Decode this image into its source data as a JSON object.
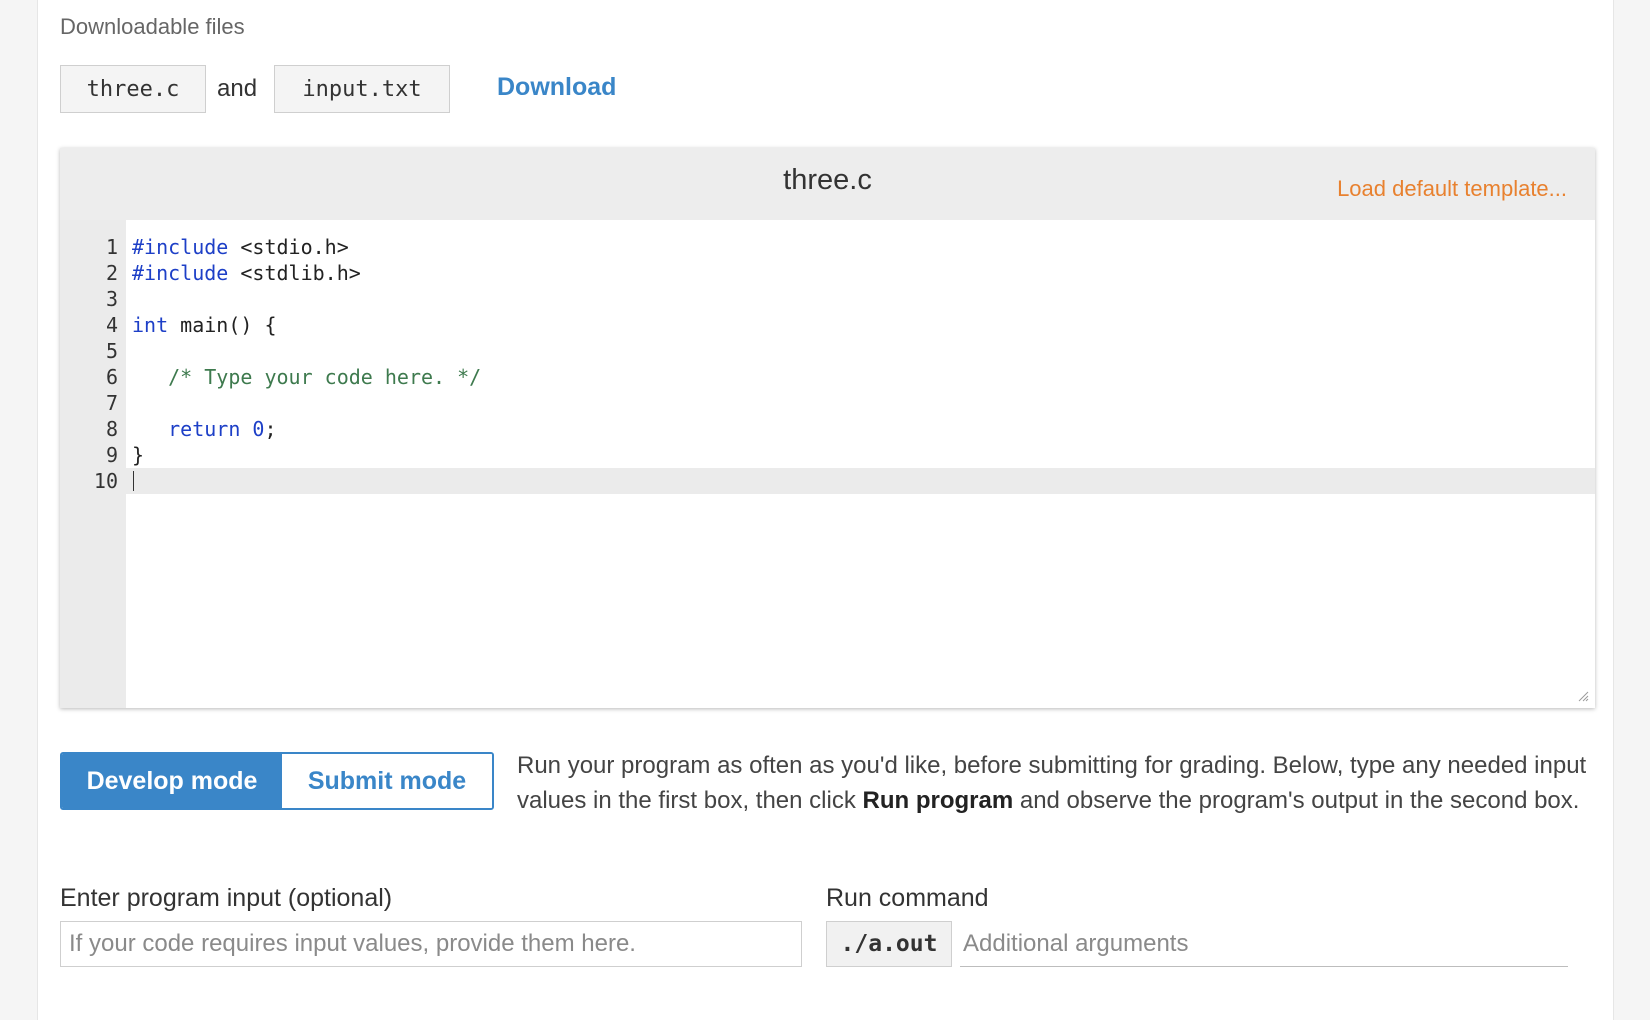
{
  "downloads": {
    "label": "Downloadable files",
    "files": [
      "three.c",
      "input.txt"
    ],
    "joiner": "and",
    "download_label": "Download"
  },
  "editor": {
    "filename": "three.c",
    "load_template_label": "Load default template...",
    "active_line": 10,
    "lines": [
      {
        "num": "1",
        "segments": [
          {
            "text": "#include",
            "style": "kw"
          },
          {
            "text": " <stdio.h>",
            "style": "plain"
          }
        ]
      },
      {
        "num": "2",
        "segments": [
          {
            "text": "#include",
            "style": "kw"
          },
          {
            "text": " <stdlib.h>",
            "style": "plain"
          }
        ]
      },
      {
        "num": "3",
        "segments": []
      },
      {
        "num": "4",
        "segments": [
          {
            "text": "int",
            "style": "kw"
          },
          {
            "text": " main() {",
            "style": "plain"
          }
        ]
      },
      {
        "num": "5",
        "segments": []
      },
      {
        "num": "6",
        "segments": [
          {
            "text": "   ",
            "style": "plain"
          },
          {
            "text": "/* Type your code here. */",
            "style": "cm"
          }
        ]
      },
      {
        "num": "7",
        "segments": []
      },
      {
        "num": "8",
        "segments": [
          {
            "text": "   ",
            "style": "plain"
          },
          {
            "text": "return",
            "style": "kw"
          },
          {
            "text": " ",
            "style": "plain"
          },
          {
            "text": "0",
            "style": "kw"
          },
          {
            "text": ";",
            "style": "plain"
          }
        ]
      },
      {
        "num": "9",
        "segments": [
          {
            "text": "}",
            "style": "plain"
          }
        ]
      },
      {
        "num": "10",
        "segments": []
      }
    ]
  },
  "modes": {
    "develop_label": "Develop mode",
    "submit_label": "Submit mode",
    "active": "develop",
    "description_before": "Run your program as often as you'd like, before submitting for grading. Below, type any needed input values in the first box, then click ",
    "description_bold": "Run program",
    "description_after": " and observe the program's output in the second box."
  },
  "program_input": {
    "label": "Enter program input (optional)",
    "placeholder": "If your code requires input values, provide them here.",
    "value": ""
  },
  "run_command": {
    "label": "Run command",
    "prefix": "./a.out",
    "args_placeholder": "Additional arguments",
    "args_value": ""
  }
}
